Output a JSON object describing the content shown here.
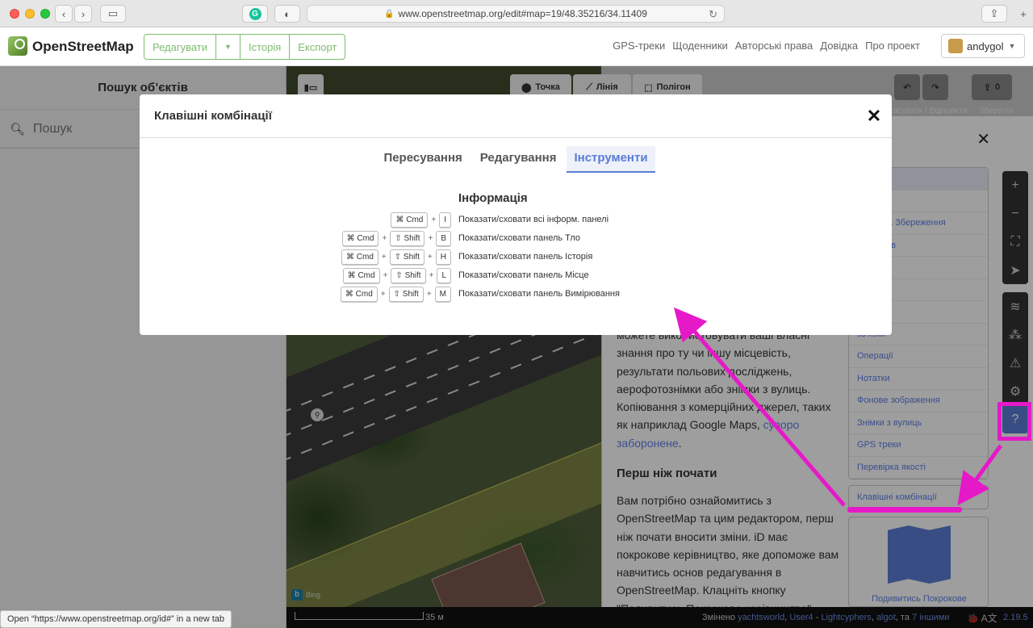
{
  "browser": {
    "url": "www.openstreetmap.org/edit#map=19/48.35216/34.11409",
    "status_link": "Open “https://www.openstreetmap.org/id#” in a new tab"
  },
  "osm": {
    "brand": "OpenStreetMap",
    "edit": "Редагувати",
    "history": "Історія",
    "export": "Експорт",
    "nav": [
      "GPS-треки",
      "Щоденники",
      "Авторські права",
      "Довідка",
      "Про проект"
    ],
    "user": "andygol"
  },
  "sidebar": {
    "title": "Пошук об’єктів",
    "search_placeholder": "Пошук"
  },
  "toolbar": {
    "point": "Точка",
    "line": "Лінія",
    "area": "Полігон",
    "undo_label": "Скасувати / Відновити",
    "save_label": "Зберегти",
    "save_count": "0"
  },
  "help": {
    "paragraph1": "можете використовувати ваші власні знання про ту чи іншу місцевість, результати польових досліджень, аерофотознімки або знімки з вулиць. Копіювання з комерційних джерел, таких як наприклад Google Maps, ",
    "paragraph1_link": "суворо заборонене",
    "paragraph1_end": ".",
    "heading2": "Перш ніж почати",
    "paragraph2": "Вам потрібно ознайомитись з OpenStreetMap та цим редактором, перш ніж почати вносити зміни. iD має покрокове керівництво, яке допоможе вам навчитись основ редагування в OpenStreetMap. Клацніть кнопку \"Подивитись Покрокове керівництво\"",
    "toc": [
      "",
      "",
      "вання та Збереження",
      "р об’єктів",
      "",
      "",
      "и",
      "зв’язки",
      "Операції",
      "Нотатки",
      "Фонове зображення",
      "Знімки з вулиць",
      "GPS треки",
      "Перевірка якості"
    ],
    "shortcuts_link": "Клавішні комбінації",
    "walkthrough": "Подивитись Покрокове"
  },
  "footer": {
    "scale": "35 м",
    "changed_by": "Змінено",
    "contributors": [
      "yachtsworld",
      "User4",
      "Lightcyphers",
      "algot"
    ],
    "and": "та",
    "others": "7 іншими",
    "version": "2.19.5"
  },
  "map": {
    "imagery": "Bing"
  },
  "modal": {
    "title": "Клавішні комбінації",
    "tabs": [
      "Пересування",
      "Редагування",
      "Інструменти"
    ],
    "active_tab": "Інструменти",
    "section": "Інформація",
    "shortcuts": [
      {
        "keys": [
          "⌘ Cmd",
          "I"
        ],
        "desc": "Показати/сховати всі інформ. панелі"
      },
      {
        "keys": [
          "⌘ Cmd",
          "⇧ Shift",
          "B"
        ],
        "desc": "Показати/сховати панель Тло"
      },
      {
        "keys": [
          "⌘ Cmd",
          "⇧ Shift",
          "H"
        ],
        "desc": "Показати/сховати панель Історія"
      },
      {
        "keys": [
          "⌘ Cmd",
          "⇧ Shift",
          "L"
        ],
        "desc": "Показати/сховати панель Місце"
      },
      {
        "keys": [
          "⌘ Cmd",
          "⇧ Shift",
          "M"
        ],
        "desc": "Показати/сховати панель Вимірювання"
      }
    ]
  },
  "colors": {
    "accent": "#5b7cd6",
    "osm_green": "#7ebc6f",
    "annotation": "#e619c8"
  }
}
